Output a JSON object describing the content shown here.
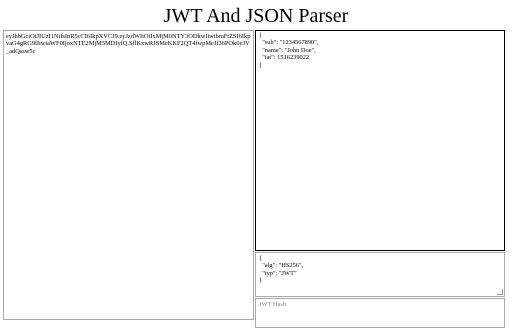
{
  "page": {
    "title": "JWT And JSON Parser"
  },
  "token_input": {
    "value": "eyJhbGciOiJIUzI1NiIsInR5cCI6IkpXVCJ9.eyJzdWIiOiIxMjM0NTY3ODkwIiwibmFtZSI6IkpvaG4gRG9lIiwiaWF0IjoxNTE2MjM5MDIyfQ.SflKxwRJSMeKKF2QT4fwpMeJf36POk6yJV_adQssw5c"
  },
  "payload_output": {
    "value": "{\n  \"sub\": \"1234567890\",\n  \"name\": \"John Doe\",\n  \"iat\": 1516239022\n}"
  },
  "header_output": {
    "value": "{\n  \"alg\": \"HS256\",\n  \"typ\": \"JWT\"\n}"
  },
  "hash_input": {
    "placeholder": "JWT Hash"
  }
}
